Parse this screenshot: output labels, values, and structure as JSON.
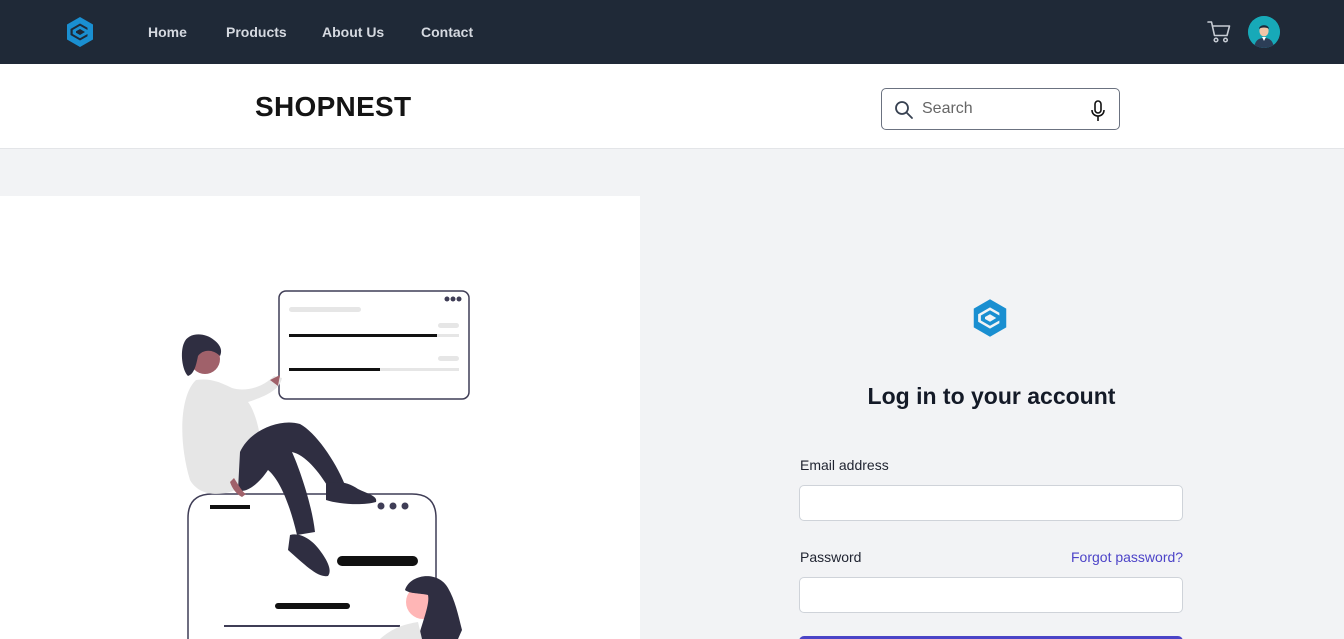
{
  "topnav": {
    "logo": "hexagon-c-logo",
    "links": [
      {
        "label": "Home"
      },
      {
        "label": "Products"
      },
      {
        "label": "About Us"
      },
      {
        "label": "Contact"
      }
    ],
    "cart_icon": "shopping-cart-icon",
    "avatar_icon": "user-avatar"
  },
  "header": {
    "brand": "SHOPNEST",
    "search": {
      "placeholder": "Search",
      "search_icon": "search-icon",
      "mic_icon": "microphone-icon"
    }
  },
  "login": {
    "logo": "hexagon-c-logo",
    "title": "Log in to your account",
    "email_label": "Email address",
    "email_value": "",
    "password_label": "Password",
    "password_value": "",
    "forgot_link": "Forgot password?"
  },
  "colors": {
    "nav_bg": "#1f2937",
    "accent": "#4b44c7",
    "logo_blue": "#1a8fd1",
    "page_bg": "#f2f3f5"
  }
}
